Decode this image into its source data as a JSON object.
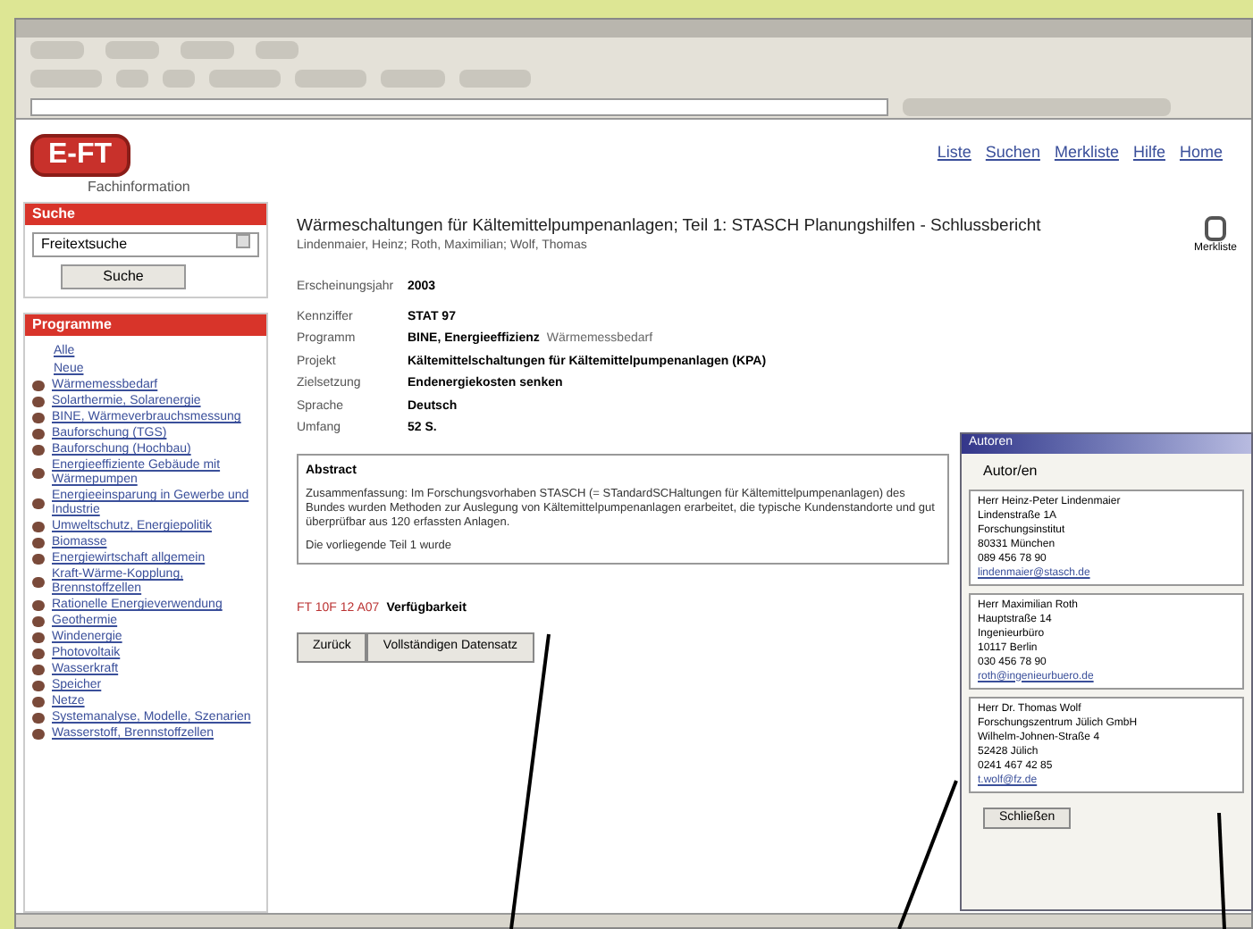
{
  "header": {
    "logo": "E-FT",
    "logo_sub": "Fachinformation",
    "links": [
      "Liste",
      "Suchen",
      "Merkliste",
      "Hilfe",
      "Home"
    ]
  },
  "sidebar": {
    "search_title": "Suche",
    "search_select": "Freitextsuche",
    "search_button": "Suche",
    "programs_title": "Programme",
    "items": [
      {
        "label": "Alle",
        "kind": "plain"
      },
      {
        "label": "Neue",
        "kind": "plain"
      },
      {
        "label": "Wärmemessbedarf",
        "kind": "bullet"
      },
      {
        "label": "Solarthermie, Solarenergie",
        "kind": "bullet"
      },
      {
        "label": "BINE, Wärmeverbrauchsmessung",
        "kind": "bullet"
      },
      {
        "label": "Bauforschung (TGS)",
        "kind": "bullet"
      },
      {
        "label": "Bauforschung (Hochbau)",
        "kind": "bullet"
      },
      {
        "label": "Energieeffiziente Gebäude mit Wärmepumpen",
        "kind": "bullet"
      },
      {
        "label": "Energieeinsparung in Gewerbe und Industrie",
        "kind": "bullet"
      },
      {
        "label": "Umweltschutz, Energiepolitik",
        "kind": "bullet"
      },
      {
        "label": "Biomasse",
        "kind": "bullet"
      },
      {
        "label": "Energiewirtschaft allgemein",
        "kind": "bullet"
      },
      {
        "label": "Kraft-Wärme-Kopplung, Brennstoffzellen",
        "kind": "bullet"
      },
      {
        "label": "Rationelle Energieverwendung",
        "kind": "bullet"
      },
      {
        "label": "Geothermie",
        "kind": "bullet"
      },
      {
        "label": "Windenergie",
        "kind": "bullet"
      },
      {
        "label": "Photovoltaik",
        "kind": "bullet"
      },
      {
        "label": "Wasserkraft",
        "kind": "bullet"
      },
      {
        "label": "Speicher",
        "kind": "bullet"
      },
      {
        "label": "Netze",
        "kind": "bullet"
      },
      {
        "label": "Systemanalyse, Modelle, Szenarien",
        "kind": "bullet"
      },
      {
        "label": "Wasserstoff, Brennstoffzellen",
        "kind": "bullet"
      }
    ]
  },
  "document": {
    "title": "Wärmeschaltungen für Kältemittelpumpenanlagen; Teil 1: STASCH Planungshilfen - Schlussbericht",
    "authors": "Lindenmaier, Heinz; Roth, Maximilian; Wolf, Thomas",
    "icon_label": "Merkliste",
    "fields": [
      {
        "label": "Erscheinungsjahr",
        "value": "2003"
      },
      {
        "label": "Kennziffer",
        "value": "STAT 97"
      },
      {
        "label": "Programm",
        "value": "BINE, Energieeffizienz",
        "extra": "Wärmemessbedarf"
      },
      {
        "label": "Projekt",
        "value": "Kältemittelschaltungen für Kältemittelpumpenanlagen (KPA)"
      },
      {
        "label": "Zielsetzung",
        "value": "Endenergiekosten senken"
      },
      {
        "label": "Sprache",
        "value": "Deutsch"
      },
      {
        "label": "Umfang",
        "value": "52 S."
      }
    ],
    "abstract_title": "Abstract",
    "abstract": "Zusammenfassung: Im Forschungsvorhaben STASCH (= STandardSCHaltungen für Kältemittelpumpenanlagen) des Bundes wurden Methoden zur Auslegung von Kältemittelpumpenanlagen erarbeitet, die typische Kundenstandorte und gut überprüfbar aus 120 erfassten Anlagen.",
    "abstract_more": "Die vorliegende Teil 1 wurde",
    "availability_prefix": "FT 10F 12 A07",
    "availability": "Verfügbarkeit",
    "buttons": [
      "Zurück",
      "Vollständigen Datensatz"
    ]
  },
  "popup": {
    "title": "Autoren",
    "heading": "Autor/en",
    "cards": [
      {
        "lines": [
          "Herr Heinz-Peter Lindenmaier",
          "Lindenstraße 1A",
          "Forschungsinstitut",
          "80331 München",
          "089 456 78 90"
        ],
        "email": "lindenmaier@stasch.de"
      },
      {
        "lines": [
          "Herr Maximilian Roth",
          "Hauptstraße 14",
          "Ingenieurbüro",
          "10117 Berlin",
          "030 456 78 90"
        ],
        "email": "roth@ingenieurbuero.de"
      },
      {
        "lines": [
          "Herr Dr. Thomas Wolf",
          "Forschungszentrum Jülich GmbH",
          "Wilhelm-Johnen-Straße 4",
          "52428 Jülich",
          "0241 467 42 85"
        ],
        "email": "t.wolf@fz.de"
      }
    ],
    "button": "Schließen"
  }
}
